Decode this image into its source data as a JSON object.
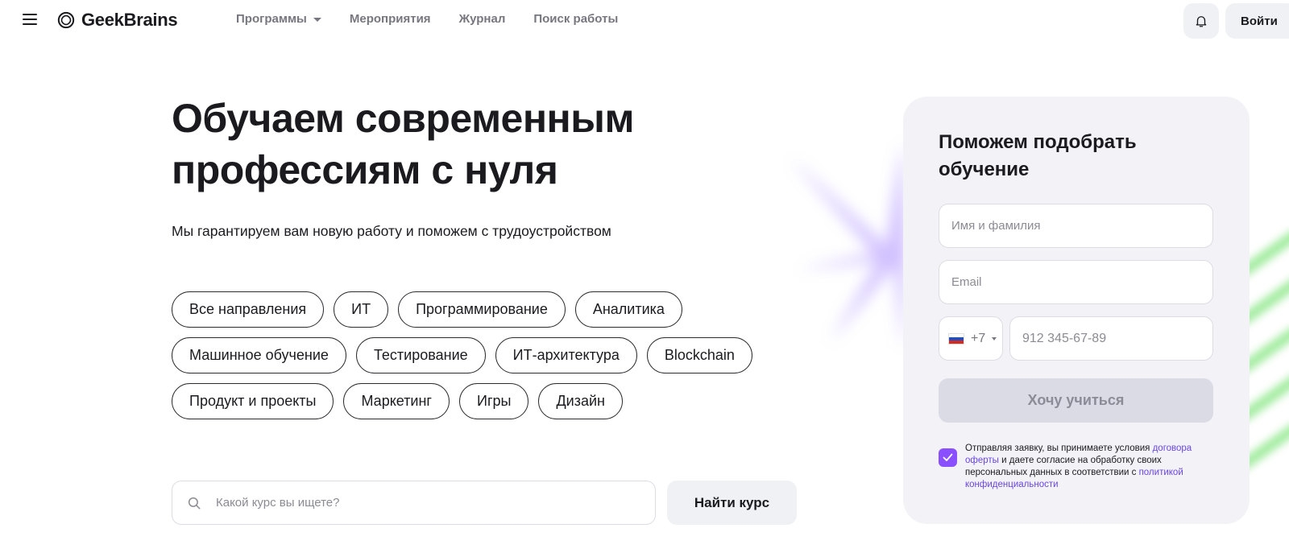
{
  "header": {
    "logo_text": "GeekBrains",
    "nav": [
      {
        "label": "Программы",
        "has_dropdown": true
      },
      {
        "label": "Мероприятия"
      },
      {
        "label": "Журнал"
      },
      {
        "label": "Поиск работы"
      }
    ],
    "bell_icon": "bell-icon",
    "login_label": "Войти"
  },
  "hero": {
    "title": "Обучаем современным профессиям с нуля",
    "subtitle": "Мы гарантируем вам новую работу и поможем с трудоустройством",
    "chip_rows": [
      [
        "Все направления",
        "ИТ",
        "Программирование",
        "Аналитика"
      ],
      [
        "Машинное обучение",
        "Тестирование",
        "ИТ-архитектура",
        "Blockchain"
      ],
      [
        "Продукт и проекты",
        "Маркетинг",
        "Игры",
        "Дизайн"
      ]
    ],
    "search_placeholder": "Какой курс вы ищете?",
    "search_button": "Найти курс"
  },
  "form": {
    "title": "Поможем подобрать обучение",
    "name_placeholder": "Имя и фамилия",
    "email_placeholder": "Email",
    "phone_code": "+7",
    "phone_placeholder": "912 345-67-89",
    "submit_label": "Хочу учиться",
    "checkbox_checked": true,
    "agree_part1": "Отправляя заявку, вы принимаете условия ",
    "agree_link1": "договора оферты",
    "agree_part2": " и даете согласие на обработку своих персональных данных в соответствии с ",
    "agree_link2": "политикой конфиденциальности"
  },
  "colors": {
    "accent": "#8a4fff",
    "link": "#6a45e0",
    "card_bg": "#f2f2f7",
    "button_bg": "#f0f1f4"
  }
}
